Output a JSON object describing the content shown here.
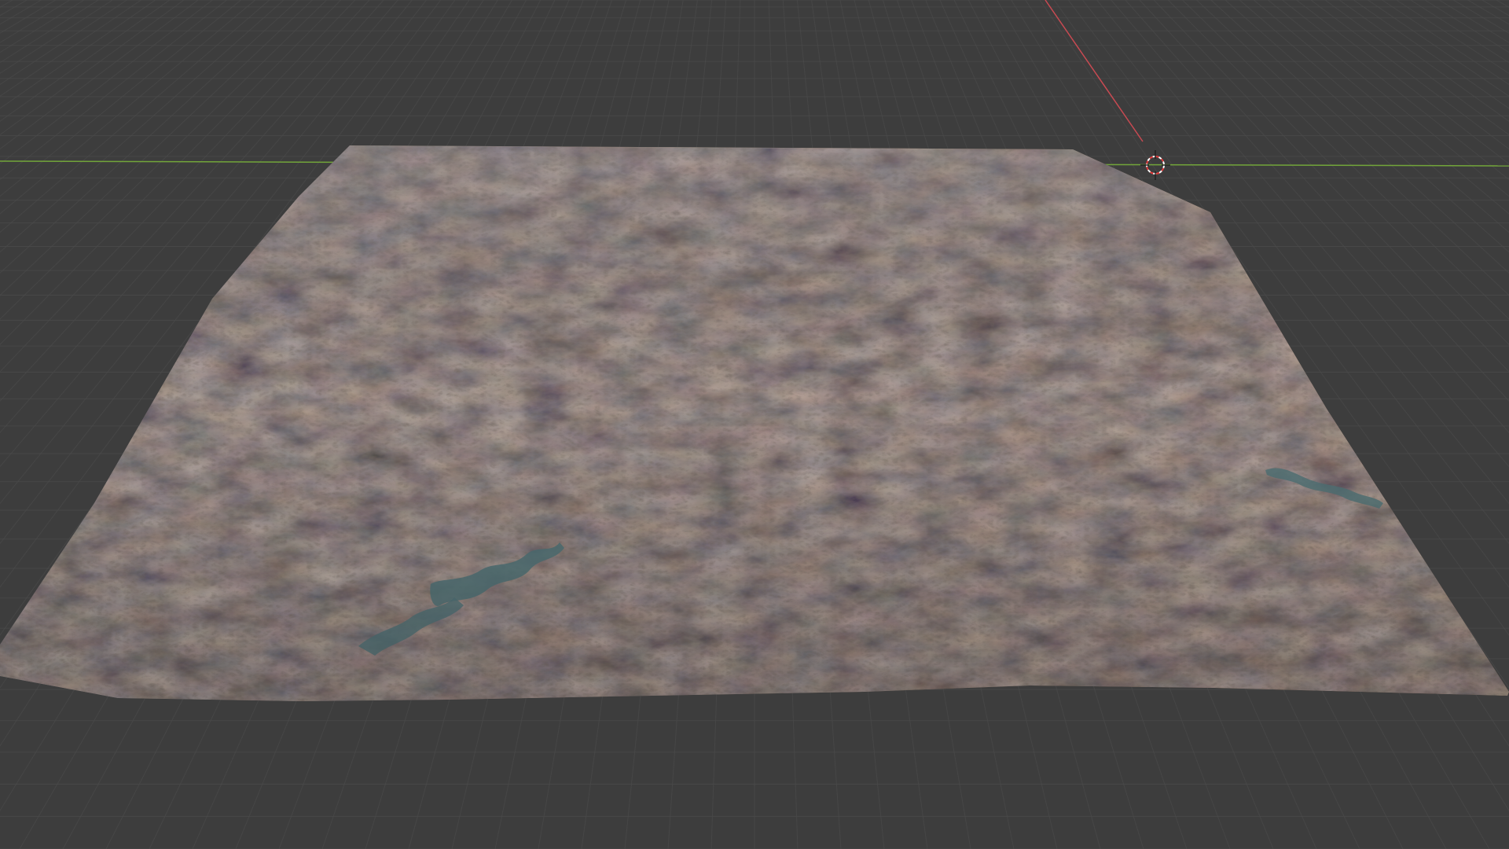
{
  "app": {
    "name": "3D viewport"
  },
  "viewport": {
    "background_color": "#3d3d3d",
    "grid_color": "#4b4b4b",
    "x_axis_color": "#c84a52",
    "y_axis_color": "#72a53a",
    "cursor_color": "#e23b3b",
    "icons": {
      "cursor": "3d-cursor-icon"
    }
  },
  "terrain": {
    "name": "terrain-mesh",
    "colors": {
      "rock_cool": "#5c6670",
      "rock_warm": "#7d5a42",
      "shadow": "#2a2623",
      "highlight": "#a08468",
      "water": "#4f7175"
    }
  }
}
